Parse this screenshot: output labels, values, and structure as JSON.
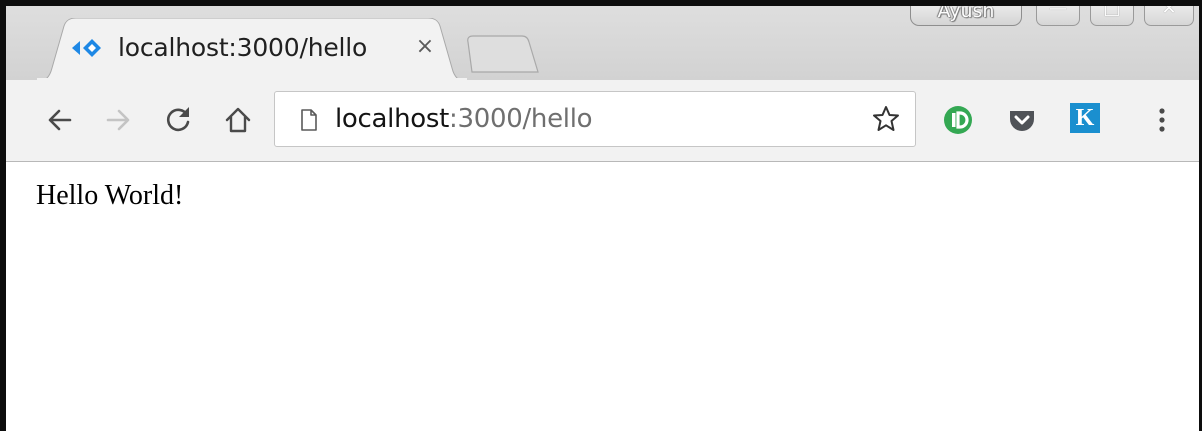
{
  "window": {
    "profile_name": "Ayush",
    "minimize_glyph": "—",
    "maximize_glyph": "□",
    "close_glyph": "✕"
  },
  "tabs": [
    {
      "title": "localhost:3000/hello",
      "favicon": "diamond-arrows-icon",
      "close_glyph": "×"
    }
  ],
  "address_bar": {
    "host": "localhost",
    "rest": ":3000/hello"
  },
  "extensions": [
    {
      "name": "green-circle-extension-icon",
      "color": "#34a853"
    },
    {
      "name": "pocket-extension-icon",
      "color": "#505358"
    },
    {
      "name": "k-extension-icon",
      "label": "K",
      "color": "#1a8fcf"
    }
  ],
  "page": {
    "body_text": "Hello World!"
  },
  "colors": {
    "favicon_blue": "#1e88e5",
    "tab_strip": "#d6d6d6",
    "toolbar": "#f2f2f2"
  }
}
